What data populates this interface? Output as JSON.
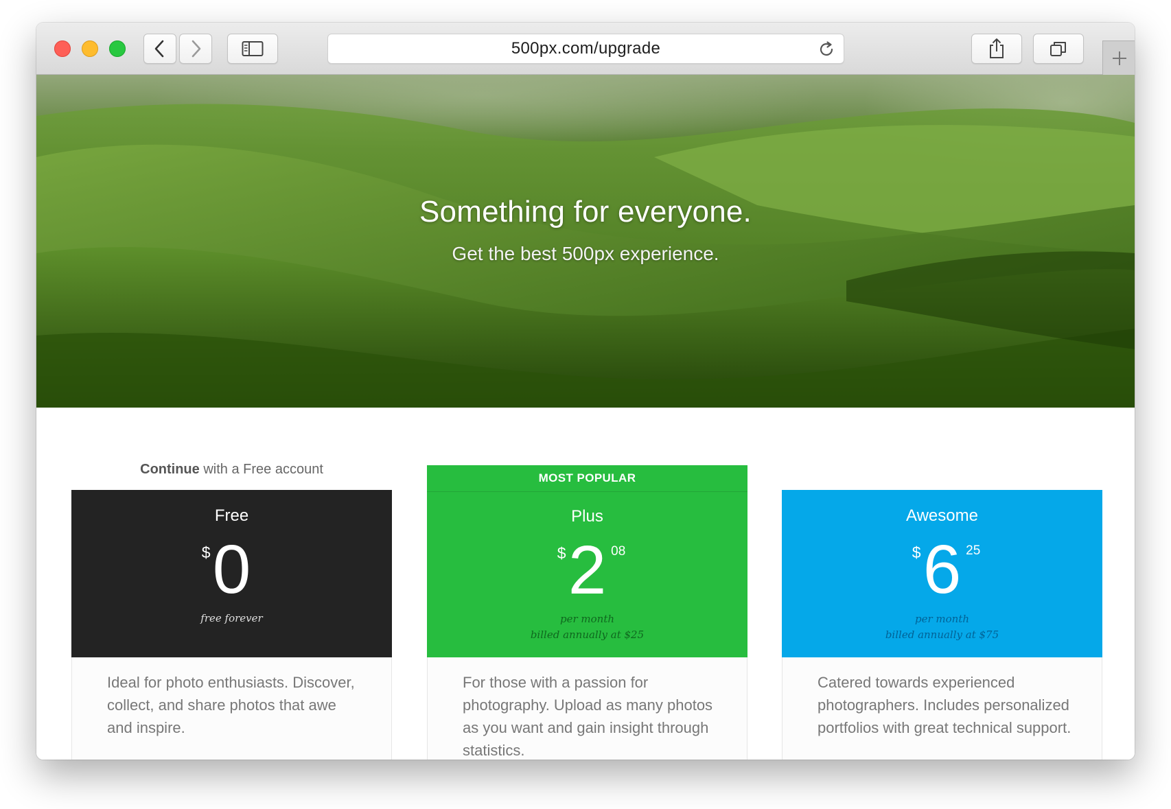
{
  "browser": {
    "url": "500px.com/upgrade",
    "traffic_lights": {
      "close": "#fe5f57",
      "minimize": "#febc2e",
      "zoom": "#28c840"
    }
  },
  "hero": {
    "title": "Something for everyone.",
    "subtitle": "Get the best 500px experience."
  },
  "continue": {
    "bold": "Continue",
    "rest": " with a Free account"
  },
  "plans": [
    {
      "name": "Free",
      "currency": "$",
      "amount": "0",
      "cents": "",
      "note_line1": "free forever",
      "note_line2": "",
      "description": "Ideal for photo enthusiasts. Discover, collect, and share photos that awe and inspire.",
      "color": "#232323"
    },
    {
      "badge": "MOST POPULAR",
      "name": "Plus",
      "currency": "$",
      "amount": "2",
      "cents": "08",
      "note_line1": "per month",
      "note_line2": "billed annually at $25",
      "description": "For those with a passion for photography. Upload as many photos as you want and gain insight through statistics.",
      "color": "#27bd3f"
    },
    {
      "name": "Awesome",
      "currency": "$",
      "amount": "6",
      "cents": "25",
      "note_line1": "per month",
      "note_line2": "billed annually at $75",
      "description": "Catered towards experienced photographers. Includes personalized portfolios with great technical support.",
      "color": "#05a8e9"
    }
  ]
}
